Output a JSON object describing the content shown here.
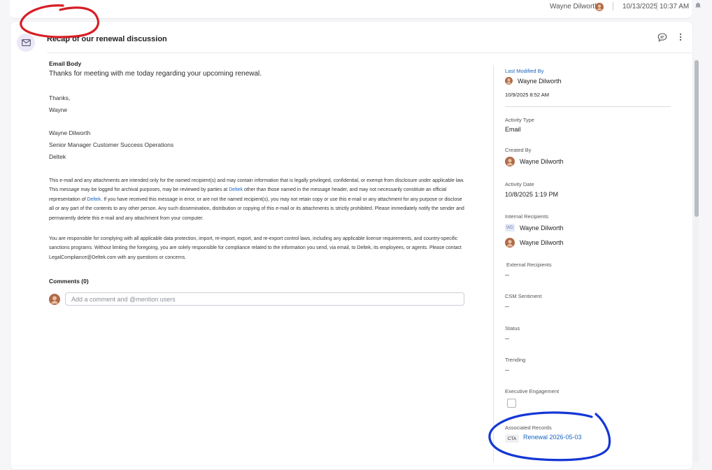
{
  "top_row": {
    "user": "Wayne Dilworth",
    "date": "10/13/2025",
    "time": "10:37 AM"
  },
  "activity": {
    "subject": "Recap of our renewal discussion",
    "email_body_label": "Email Body",
    "body_first_line": "Thanks for meeting with me today regarding your upcoming renewal.",
    "signoff": "Thanks,\nWayne",
    "signature": "Wayne Dilworth\nSenior Manager Customer Success Operations\nDeltek",
    "disclaimer_1": {
      "part1": "This e-mail and any attachments are intended only for the named recipient(s) and may contain information that is legally privileged, confidential, or exempt from disclosure under applicable law. This message may be logged for archival purposes, may be reviewed by parties at ",
      "link1": "Deltek",
      "part2": " other than those named in the message header, and may not necessarily constitute an official representation of ",
      "link2": "Deltek",
      "part3": ". If you have received this message in error, or are not the named recipient(s), you may not retain copy or use this e-mail or any attachment for any purpose or disclose all or any part of the contents to any other person. Any such dissemination, distribution or copying of this e-mail or its attachments is strictly prohibited. Please immediately notify the sender and permanently delete this e-mail and any attachment from your computer."
    },
    "disclaimer_2": "You are responsible for complying with all applicable data protection, import, re-import, export, and re-export control laws, including any applicable license requirements, and country-specific sanctions programs. Without limiting the foregoing, you are solely responsible for compliance related to the information you send, via email, to Deltek, its employees, or agents. Please contact LegalCompliance@Deltek.com with any questions or concerns.",
    "comments_label": "Comments (0)",
    "comment_placeholder": "Add a comment and @mention users"
  },
  "sidebar": {
    "last_modified_label": "Last Modified By",
    "last_modified_by": "Wayne Dilworth",
    "last_modified_date": "10/9/2025 8:52 AM",
    "activity_type_label": "Activity Type",
    "activity_type": "Email",
    "created_by_label": "Created By",
    "created_by": "Wayne Dilworth",
    "activity_date_label": "Activity Date",
    "activity_date": "10/8/2025 1:19 PM",
    "internal_recipients_label": "Internal Recipients",
    "internal_recipient_initials": "WD",
    "internal_recipients": [
      "Wayne Dilworth",
      "Wayne Dilworth"
    ],
    "external_recipients_label": "External Recipients",
    "external_recipients": "--",
    "csm_sentiment_label": "CSM Sentiment",
    "csm_sentiment": "--",
    "status_label": "Status",
    "status": "--",
    "trending_label": "Trending",
    "trending": "--",
    "executive_engagement_label": "Executive Engagement",
    "executive_engagement": false,
    "associated_records_label": "Associated Records",
    "associated_badge": "CTA",
    "associated_record": "Renewal 2026-05-03"
  },
  "colors": {
    "link": "#1a63c2",
    "annotation_red": "#d61f26",
    "annotation_blue": "#1437d6"
  }
}
